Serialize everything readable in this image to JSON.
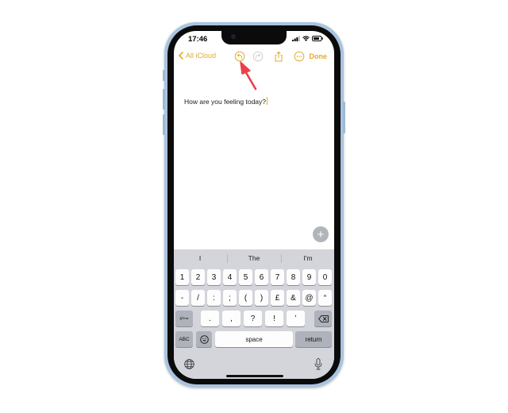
{
  "status_bar": {
    "time": "17:46"
  },
  "toolbar": {
    "back_label": "All iCloud",
    "done_label": "Done",
    "accent_color": "#e2ab2d"
  },
  "note": {
    "text": "How are you feeling today?"
  },
  "keyboard": {
    "suggestions": [
      "I",
      "The",
      "I'm"
    ],
    "row1": [
      "1",
      "2",
      "3",
      "4",
      "5",
      "6",
      "7",
      "8",
      "9",
      "0"
    ],
    "row2": [
      "-",
      "/",
      ":",
      ";",
      "(",
      ")",
      "£",
      "&",
      "@",
      "“"
    ],
    "row3_toggle": "#+=",
    "row3": [
      ".",
      ",",
      "?",
      "!",
      "’"
    ],
    "abc_label": "ABC",
    "space_label": "space",
    "return_label": "return"
  },
  "annotation": {
    "color": "#e8414a"
  },
  "icons": {
    "back": "chevron-left-icon",
    "undo": "undo-icon",
    "redo": "redo-icon",
    "share": "share-icon",
    "more": "more-icon",
    "add": "add-icon",
    "globe": "globe-icon",
    "mic": "microphone-icon",
    "emoji": "emoji-icon",
    "delete": "delete-icon"
  }
}
